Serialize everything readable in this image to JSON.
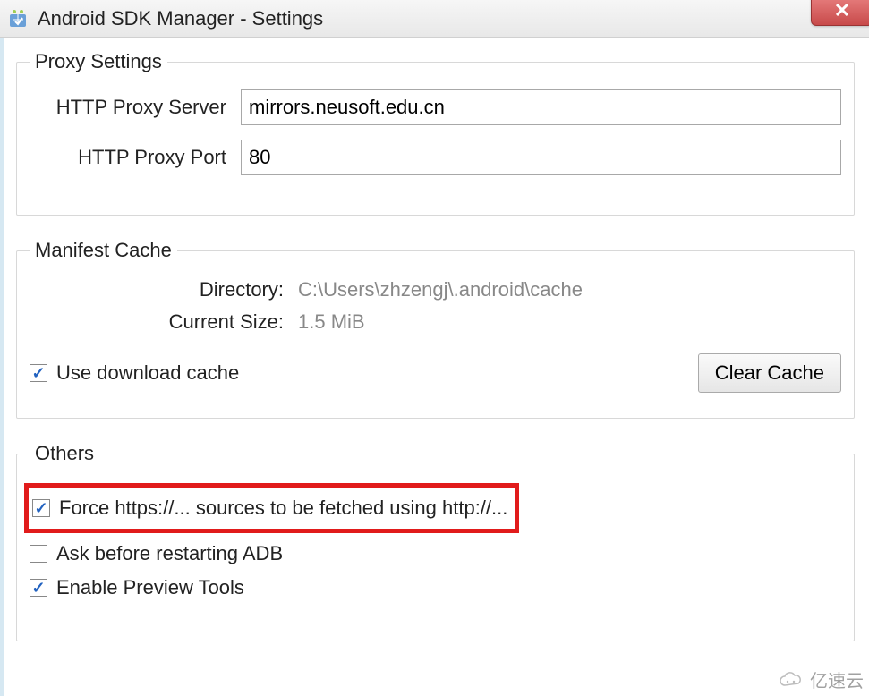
{
  "window": {
    "title": "Android SDK Manager - Settings"
  },
  "proxy": {
    "legend": "Proxy Settings",
    "server_label": "HTTP Proxy Server",
    "server_value": "mirrors.neusoft.edu.cn",
    "port_label": "HTTP Proxy Port",
    "port_value": "80"
  },
  "cache": {
    "legend": "Manifest Cache",
    "directory_label": "Directory:",
    "directory_value": "C:\\Users\\zhzengj\\.android\\cache",
    "size_label": "Current Size:",
    "size_value": "1.5 MiB",
    "use_cache_label": "Use download cache",
    "use_cache_checked": true,
    "clear_button": "Clear Cache"
  },
  "others": {
    "legend": "Others",
    "force_https_label": "Force https://... sources to be fetched using http://...",
    "force_https_checked": true,
    "ask_adb_label": "Ask before restarting ADB",
    "ask_adb_checked": false,
    "preview_tools_label": "Enable Preview Tools",
    "preview_tools_checked": true
  },
  "watermark": "亿速云"
}
